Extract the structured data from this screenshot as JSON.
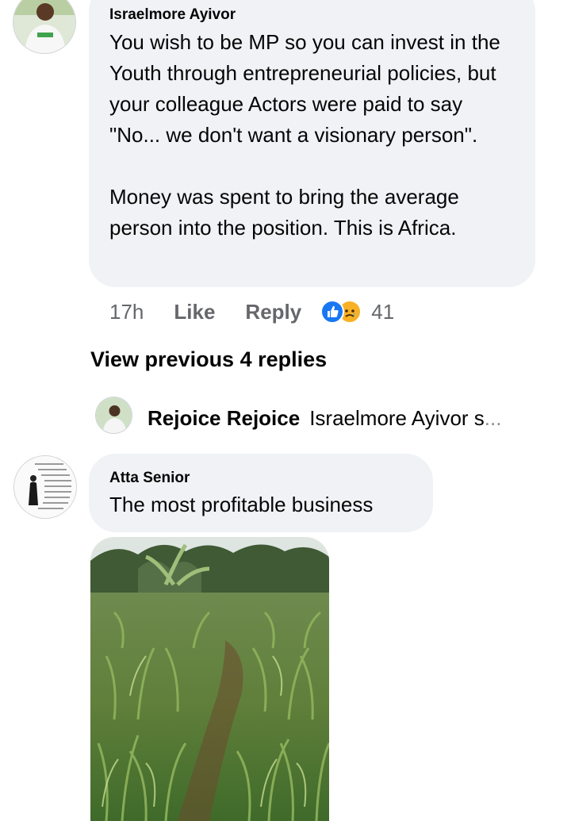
{
  "comment1": {
    "author": "Israelmore Ayivor",
    "text": "You wish to be MP so you can invest in the Youth through entrepreneurial policies, but your colleague Actors were paid to say \"No... we don't want a visionary person\".\n\nMoney was spent to bring the average person into the position. This is Africa.",
    "time": "17h",
    "like_label": "Like",
    "reply_label": "Reply",
    "reaction_icons": [
      "like-icon",
      "sad-icon"
    ],
    "reaction_count": "41"
  },
  "view_previous": "View previous 4 replies",
  "reply_preview": {
    "author": "Rejoice Rejoice",
    "text": "Israelmore Ayivor s",
    "ellipsis": "..."
  },
  "comment2": {
    "author": "Atta Senior",
    "text": "The most profitable business"
  },
  "colors": {
    "bubble": "#f0f2f5",
    "secondary_text": "#65676b",
    "like_blue": "#1877f2",
    "sad_yellow": "#f7b125"
  }
}
